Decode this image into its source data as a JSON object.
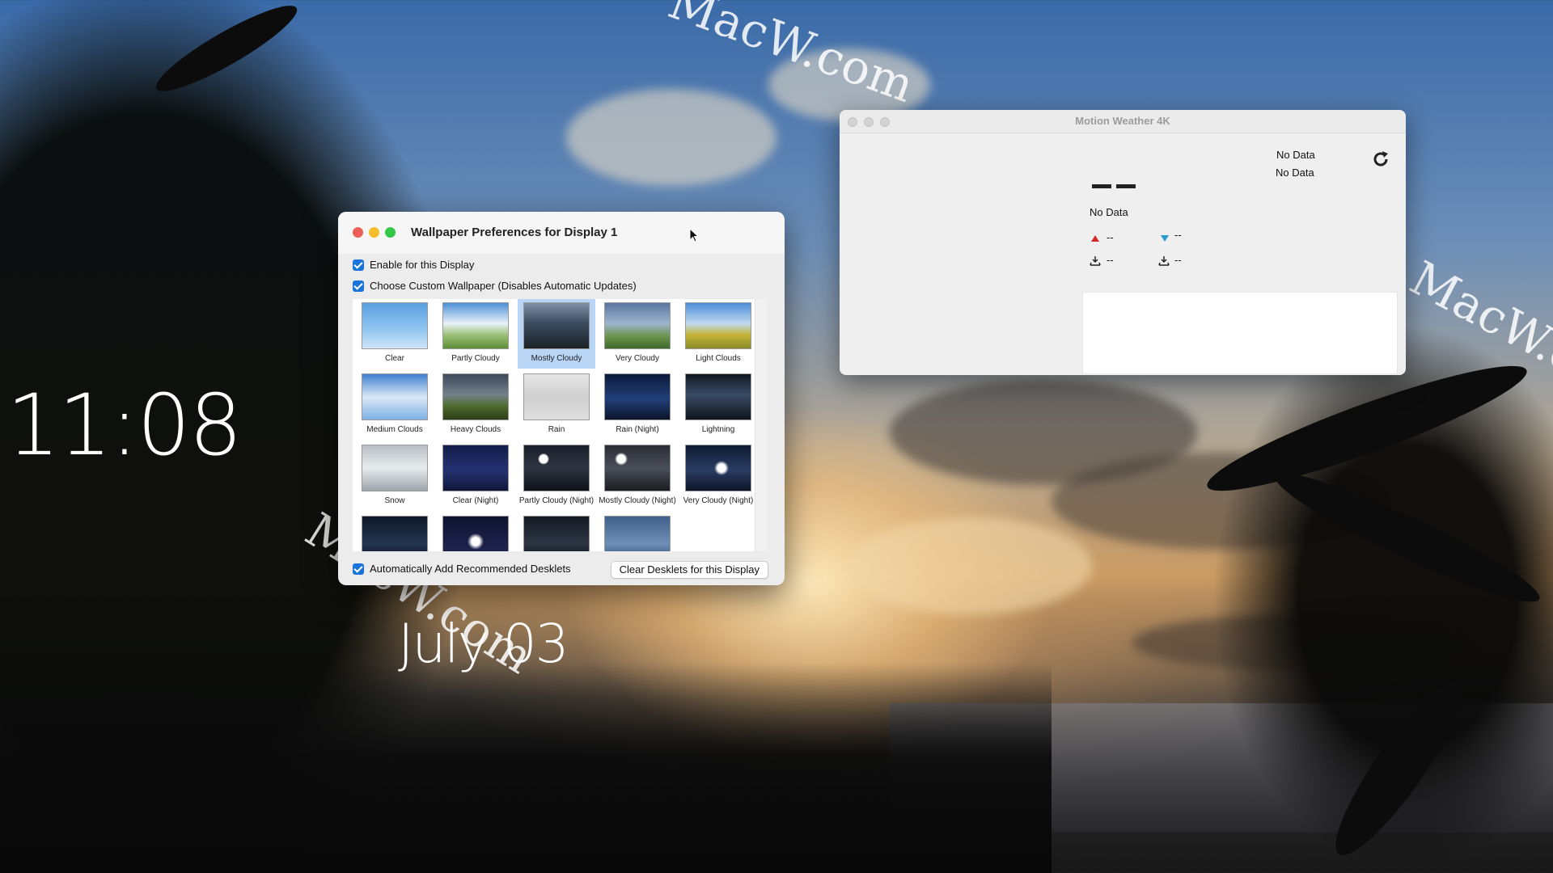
{
  "desktop": {
    "clock": "11:08",
    "date": "July 03",
    "watermark": "MacW.com"
  },
  "prefs_window": {
    "title": "Wallpaper Preferences for Display 1",
    "enable_label": "Enable for this Display",
    "custom_label": "Choose Custom Wallpaper (Disables Automatic Updates)",
    "auto_add_label": "Automatically Add Recommended Desklets",
    "clear_button": "Clear Desklets for this Display",
    "selected": "Mostly Cloudy",
    "wallpapers": [
      {
        "label": "Clear",
        "thumb": "clear"
      },
      {
        "label": "Partly Cloudy",
        "thumb": "partly"
      },
      {
        "label": "Mostly Cloudy",
        "thumb": "mostly"
      },
      {
        "label": "Very Cloudy",
        "thumb": "very"
      },
      {
        "label": "Light Clouds",
        "thumb": "light"
      },
      {
        "label": "Medium Clouds",
        "thumb": "medium"
      },
      {
        "label": "Heavy Clouds",
        "thumb": "heavy"
      },
      {
        "label": "Rain",
        "thumb": "rain"
      },
      {
        "label": "Rain (Night)",
        "thumb": "rainnight"
      },
      {
        "label": "Lightning",
        "thumb": "lightning"
      },
      {
        "label": "Snow",
        "thumb": "snow"
      },
      {
        "label": "Clear (Night)",
        "thumb": "clearnight"
      },
      {
        "label": "Partly Cloudy (Night)",
        "thumb": "partlynight"
      },
      {
        "label": "Mostly Cloudy (Night)",
        "thumb": "mostlynight"
      },
      {
        "label": "Very Cloudy (Night)",
        "thumb": "verynight"
      },
      {
        "label": "",
        "thumb": "row4a"
      },
      {
        "label": "",
        "thumb": "row4b"
      },
      {
        "label": "",
        "thumb": "row4c"
      },
      {
        "label": "",
        "thumb": "row4d"
      }
    ]
  },
  "weather_window": {
    "title": "Motion Weather 4K",
    "location_line1": "No Data",
    "location_line2": "No Data",
    "condition": "No Data",
    "high": "--",
    "low": "--",
    "precip1": "--",
    "precip2": "--",
    "colors": {
      "high": "#d12a2a",
      "low": "#2a9bd1"
    }
  }
}
